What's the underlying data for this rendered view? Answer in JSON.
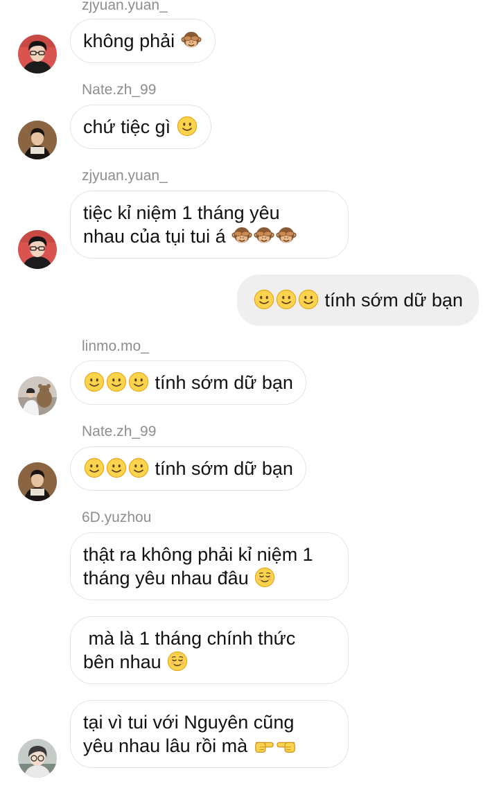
{
  "messages": [
    {
      "sender": "zjyuan.yuan_",
      "text": "không phải",
      "emoji": [
        "monkey"
      ]
    },
    {
      "sender": "Nate.zh_99",
      "text": "chứ tiệc gì",
      "emoji": [
        "smile"
      ]
    },
    {
      "sender": "zjyuan.yuan_",
      "line1": "tiệc kỉ niệm 1 tháng yêu",
      "line2": "nhau của tụi tui á",
      "emoji": [
        "monkey",
        "monkey",
        "monkey"
      ]
    },
    {
      "sender": "me",
      "text": "tính sớm dữ bạn",
      "emoji": [
        "smile",
        "smile",
        "smile"
      ]
    },
    {
      "sender": "linmo.mo_",
      "text": "tính sớm dữ bạn",
      "emoji": [
        "smile",
        "smile",
        "smile"
      ]
    },
    {
      "sender": "Nate.zh_99",
      "text": "tính sớm dữ bạn",
      "emoji": [
        "smile",
        "smile",
        "smile"
      ]
    },
    {
      "sender": "6D.yuzhou",
      "line1": "thật ra không phải kỉ niệm 1",
      "line2": "tháng yêu nhau đâu",
      "emoji": [
        "relieved"
      ]
    },
    {
      "sender": "6D.yuzhou",
      "line1": " mà là 1 tháng chính thức",
      "line2": "bên nhau",
      "emoji": [
        "relieved"
      ]
    },
    {
      "sender": "6D.yuzhou",
      "line1": "tại vì tui với Nguyên cũng",
      "line2": "yêu nhau lâu rồi mà",
      "emoji": [
        "point-right",
        "point-left"
      ]
    }
  ],
  "colors": {
    "incoming_bubble": "#ffffff",
    "outgoing_bubble": "#efefef",
    "sender_name": "#8e8e8e"
  }
}
